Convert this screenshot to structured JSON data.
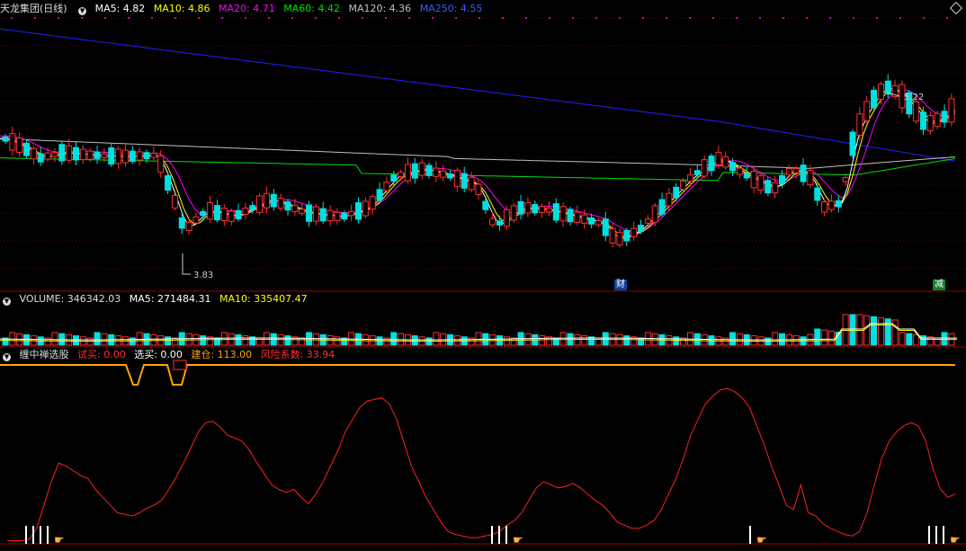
{
  "header": {
    "stock_name": "天龙集团(日线)",
    "ma5": "MA5: 4.82",
    "ma10": "MA10: 4.86",
    "ma20": "MA20: 4.71",
    "ma60": "MA60: 4.42",
    "ma120": "MA120: 4.36",
    "ma250": "MA250: 4.55"
  },
  "price_panel": {
    "high_label": "5.22",
    "low_label": "3.83",
    "tag_cai": "财",
    "tag_jian": "减"
  },
  "volume_header": {
    "volume": "VOLUME: 346342.03",
    "ma5": "MA5: 271484.31",
    "ma10": "MA10: 335407.47"
  },
  "indicator_header": {
    "name": "缠中禅选股",
    "shimai": "试买: 0.00",
    "xuanmai": "选买: 0.00",
    "jiancang": "建仓: 113.00",
    "fengxian": "风险系数: 33.94"
  },
  "colors": {
    "ma5": "#ffffff",
    "ma10": "#ffff00",
    "ma20": "#ff00ff",
    "ma60": "#00e000",
    "ma120": "#c0c0c0",
    "ma250": "#2020ff",
    "up": "#ff3030",
    "down": "#00e0e0",
    "risk_line": "#ff2020",
    "build_line": "#ffa500"
  },
  "chart_data": {
    "type": "candlestick",
    "price_ylim": [
      3.6,
      5.5
    ],
    "risk_ylim": [
      0,
      110
    ],
    "risk_values": [
      2,
      2,
      2,
      3,
      10,
      25,
      40,
      52,
      50,
      47,
      44,
      42,
      35,
      30,
      25,
      20,
      19,
      18,
      20,
      23,
      25,
      28,
      35,
      43,
      52,
      62,
      72,
      78,
      79,
      75,
      70,
      68,
      66,
      60,
      52,
      45,
      38,
      35,
      33,
      35,
      30,
      26,
      32,
      40,
      50,
      60,
      72,
      80,
      88,
      92,
      93,
      94,
      90,
      80,
      65,
      50,
      40,
      30,
      22,
      14,
      8,
      6,
      5,
      4,
      4,
      5,
      6,
      8,
      12,
      15,
      20,
      28,
      36,
      40,
      38,
      36,
      37,
      39,
      36,
      32,
      28,
      25,
      20,
      14,
      12,
      10,
      10,
      12,
      15,
      22,
      32,
      42,
      55,
      70,
      80,
      90,
      95,
      99,
      100,
      98,
      94,
      88,
      76,
      64,
      50,
      38,
      25,
      22,
      38,
      20,
      18,
      13,
      10,
      8,
      6,
      5,
      8,
      20,
      38,
      55,
      66,
      72,
      76,
      78,
      76,
      66,
      48,
      35,
      30,
      32
    ],
    "candles_count": 135
  }
}
